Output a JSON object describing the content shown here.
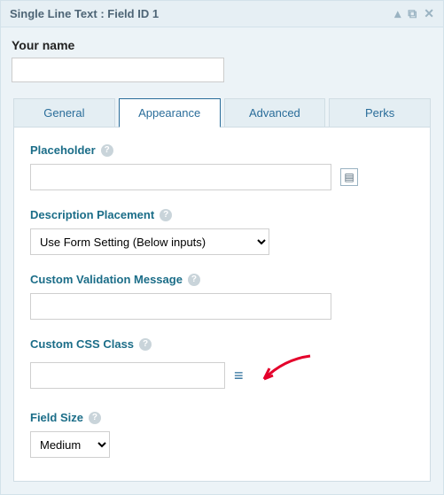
{
  "header": {
    "title": "Single Line Text : Field ID 1"
  },
  "preview": {
    "label": "Your name",
    "value": ""
  },
  "tabs": {
    "general": "General",
    "appearance": "Appearance",
    "advanced": "Advanced",
    "perks": "Perks"
  },
  "placeholder": {
    "label": "Placeholder",
    "value": ""
  },
  "descPlacement": {
    "label": "Description Placement",
    "value": "Use Form Setting (Below inputs)"
  },
  "validation": {
    "label": "Custom Validation Message",
    "value": ""
  },
  "cssClass": {
    "label": "Custom CSS Class",
    "value": ""
  },
  "fieldSize": {
    "label": "Field Size",
    "value": "Medium"
  },
  "helpGlyph": "?"
}
